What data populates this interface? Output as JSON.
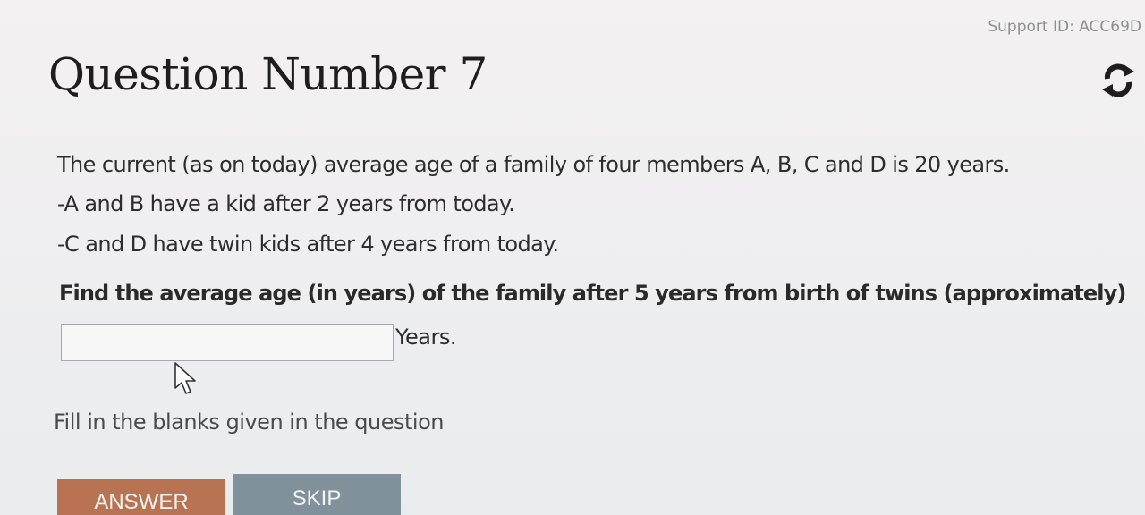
{
  "header": {
    "support_id": "Support ID: ACC69D",
    "title": "Question Number 7"
  },
  "question": {
    "lines": [
      "The current (as on today) average age of a family of four members A, B, C and D is 20 years.",
      "-A and B have a kid after 2 years from today.",
      "-C and D have twin kids after 4 years from today."
    ],
    "ask": "Find the average age (in years) of the family after 5 years from birth of twins (approximately)"
  },
  "answer_field": {
    "value": "",
    "placeholder": "",
    "unit": "Years."
  },
  "hint": "Fill in the blanks given in the question",
  "actions": {
    "answer_label": "ANSWER",
    "skip_label": "SKIP"
  },
  "icons": {
    "refresh": "refresh-icon",
    "cursor": "cursor-icon"
  },
  "colors": {
    "answer_button": "#b87452",
    "skip_button": "#80919b"
  }
}
